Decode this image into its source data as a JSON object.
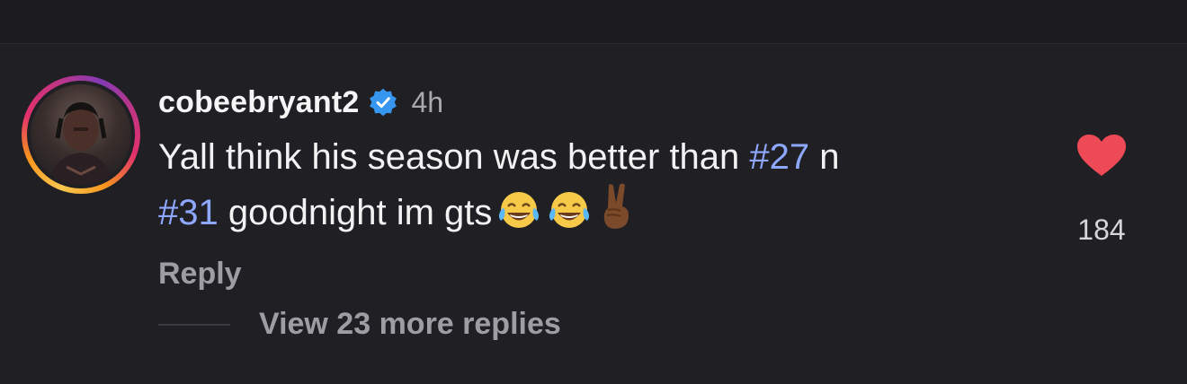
{
  "comment": {
    "username": "cobeebryant2",
    "verified_icon": "verified-badge-icon",
    "timestamp": "4h",
    "text_part1": "Yall think his season was better than ",
    "hashtag1": "#27",
    "text_part2": " n",
    "hashtag2": "#31",
    "text_part3": " goodnight im gts",
    "emojis": [
      "face-with-tears-of-joy",
      "face-with-tears-of-joy",
      "victory-hand-medium-dark-skin"
    ],
    "like_count": "184",
    "like_icon": "heart-icon",
    "reply_label": "Reply",
    "view_replies_label": "View 23 more replies"
  },
  "colors": {
    "background": "#1f1f24",
    "hashtag": "#8fa8ff",
    "heart": "#ed4956",
    "verified": "#3797f0",
    "muted": "#9d9da3"
  }
}
